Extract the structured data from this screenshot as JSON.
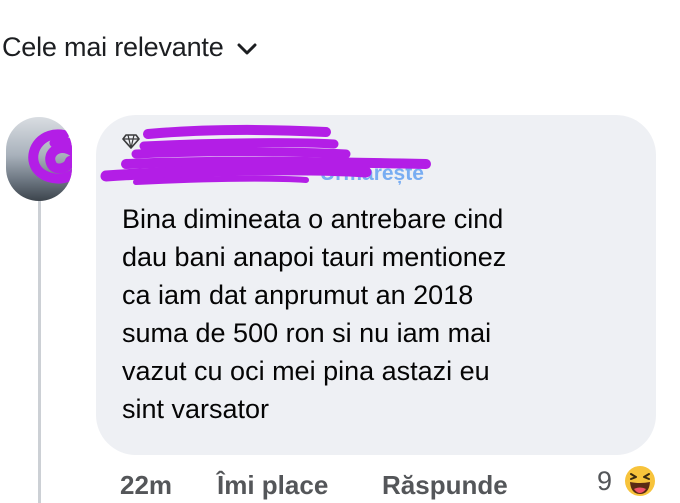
{
  "header": {
    "sort_label": "Cele mai relevante"
  },
  "comment": {
    "author": "",
    "follow_label": "Urmărește",
    "text": "Bina dimineata o antrebare cind\ndau bani anapoi tauri mentionez\nca iam dat anprumut an 2018\nsuma de 500 ron si nu iam mai\nvazut cu oci mei pina astazi eu\nsint varsator",
    "time": "22m",
    "like_label": "Îmi place",
    "reply_label": "Răspunde",
    "reaction_count": "9"
  },
  "icons": {
    "sort": "chevron-down-icon",
    "badge": "diamond-icon",
    "reaction": "haha-emoji-icon"
  },
  "colors": {
    "bubble": "#eef0f4",
    "redaction": "#b31ee6",
    "link": "#1877f2",
    "text": "#050505",
    "meta": "#545659"
  }
}
